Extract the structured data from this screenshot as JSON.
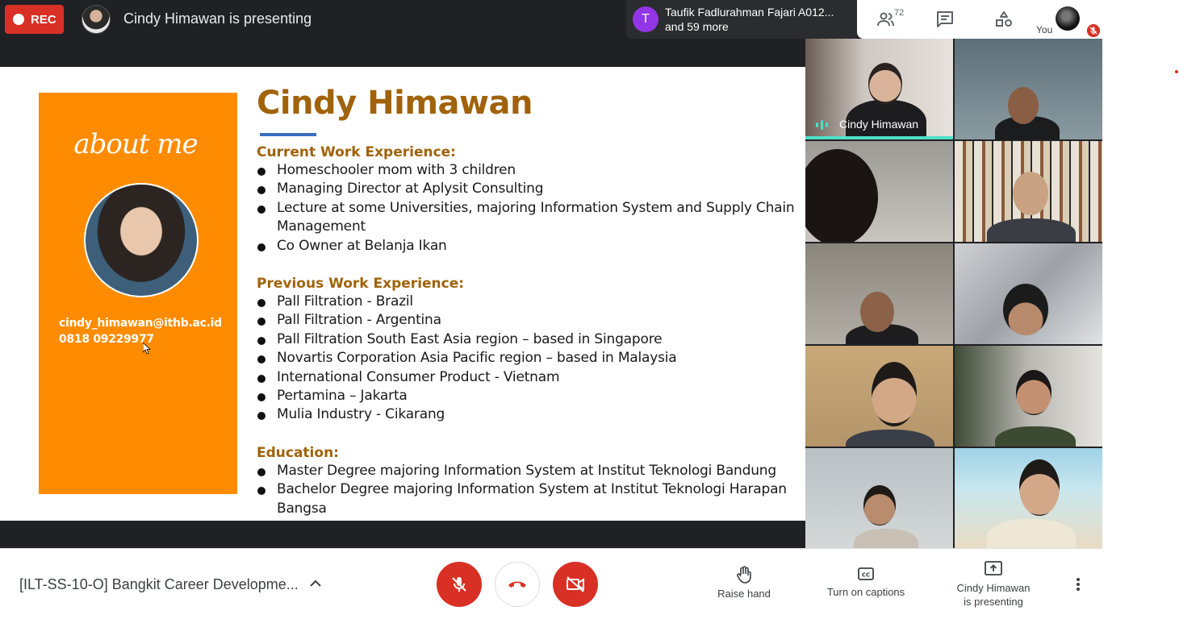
{
  "topbar": {
    "rec_label": "REC",
    "presenting_text": "Cindy Himawan is presenting",
    "participant_strip": {
      "avatar_letter": "T",
      "line1": "Taufik Fadlurahman Fajari A012...",
      "line2": "and 59 more",
      "avatar_color": "#9334e6"
    },
    "people_count": "72",
    "you_label": "You"
  },
  "slide": {
    "about_me": "about me",
    "email": "cindy_himawan@ithb.ac.id",
    "phone": "0818 09229977",
    "name": "Cindy Himawan",
    "current_heading": "Current Work Experience:",
    "current_items": [
      "Homeschooler mom with 3 children",
      "Managing Director at Aplysit Consulting",
      "Lecture at some Universities, majoring Information System and Supply Chain Management",
      "Co Owner at Belanja Ikan"
    ],
    "previous_heading": "Previous Work Experience:",
    "previous_items": [
      "Pall Filtration - Brazil",
      "Pall Filtration - Argentina",
      "Pall Filtration South East Asia region – based in Singapore",
      "Novartis Corporation Asia Pacific region – based in Malaysia",
      "International Consumer Product - Vietnam",
      "Pertamina – Jakarta",
      "Mulia Industry - Cikarang"
    ],
    "education_heading": "Education:",
    "education_items": [
      "Master Degree majoring Information System at Institut Teknologi Bandung",
      "Bachelor Degree majoring Information System at Institut Teknologi Harapan Bangsa"
    ],
    "colors": {
      "orange_panel": "#ff8c00",
      "heading": "#a0620a",
      "underline": "#3a6dbf"
    }
  },
  "video_grid": {
    "speaker_name": "Cindy Himawan",
    "speaking_color": "#4ee0c8"
  },
  "bottombar": {
    "meeting_title": "[ILT-SS-10-O] Bangkit Career Developme...",
    "raise_hand": "Raise hand",
    "captions": "Turn on captions",
    "present_line1": "Cindy Himawan",
    "present_line2": "is presenting",
    "danger_color": "#d93025"
  }
}
